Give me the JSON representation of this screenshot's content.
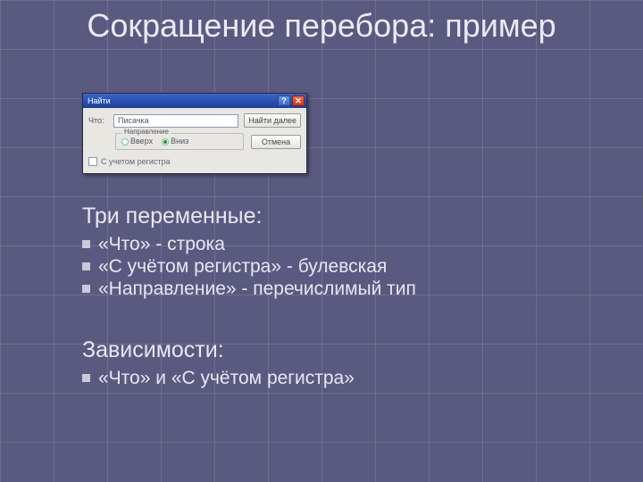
{
  "title": "Сокращение перебора: пример",
  "dialog": {
    "caption": "Найти",
    "help_glyph": "?",
    "close_glyph": "✕",
    "what_label": "Что:",
    "what_value": "Писачка",
    "find_next": "Найти далее",
    "cancel": "Отмена",
    "direction_caption": "Направление",
    "dir_up": "Вверх",
    "dir_down": "Вниз",
    "case_label": "С учетом регистра"
  },
  "sections": {
    "vars_heading": "Три переменные:",
    "vars": [
      "«Что» - строка",
      "«С учётом регистра» - булевская",
      "«Направление» - перечислимый тип"
    ],
    "deps_heading": "Зависимости:",
    "deps": [
      "«Что» и «С учётом регистра»"
    ]
  }
}
